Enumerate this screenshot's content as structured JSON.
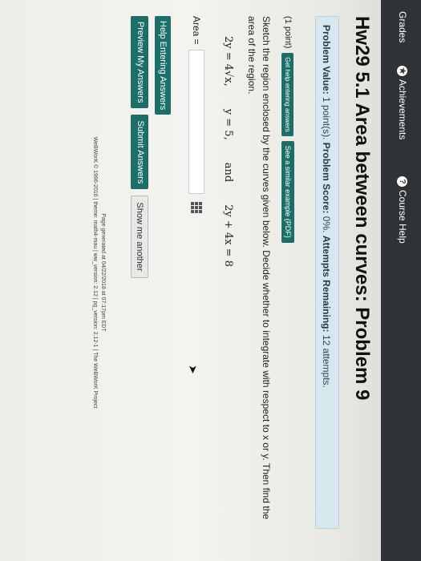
{
  "nav": {
    "grades": "Grades",
    "achievements": "Achievements",
    "course_help": "Course Help"
  },
  "problem": {
    "title": "Hw29 5.1 Area between curves: Problem 9",
    "value_label": "Problem Value:",
    "value": "1 point(s).",
    "score_label": "Problem Score:",
    "score": "0%.",
    "attempts_label": "Attempts Remaining:",
    "attempts": "12 attempts.",
    "points": "(1 point)",
    "help_btn": "Get help entering answers",
    "similar_btn": "See a similar example (PDF)",
    "instruction": "Sketch the region enclosed by the curves given below. Decide whether to integrate with respect to x or y. Then find the area of the region.",
    "eq1": "2y = 4√x,",
    "eq2": "y = 5,",
    "eq_and": "and",
    "eq3": "2y + 4x = 8",
    "area_label": "Area ="
  },
  "buttons": {
    "help_entering": "Help Entering Answers",
    "preview": "Preview My Answers",
    "submit": "Submit Answers",
    "show_another": "Show me another"
  },
  "footer": {
    "generated": "Page generated at 04/22/2018 at 07:17pm EDT",
    "credits": "WeBWorK © 1996-2016 | theme: math4-mau | ww_version: 2.12 | pg_version: 2.12-1 | The WeBWorK Project"
  }
}
